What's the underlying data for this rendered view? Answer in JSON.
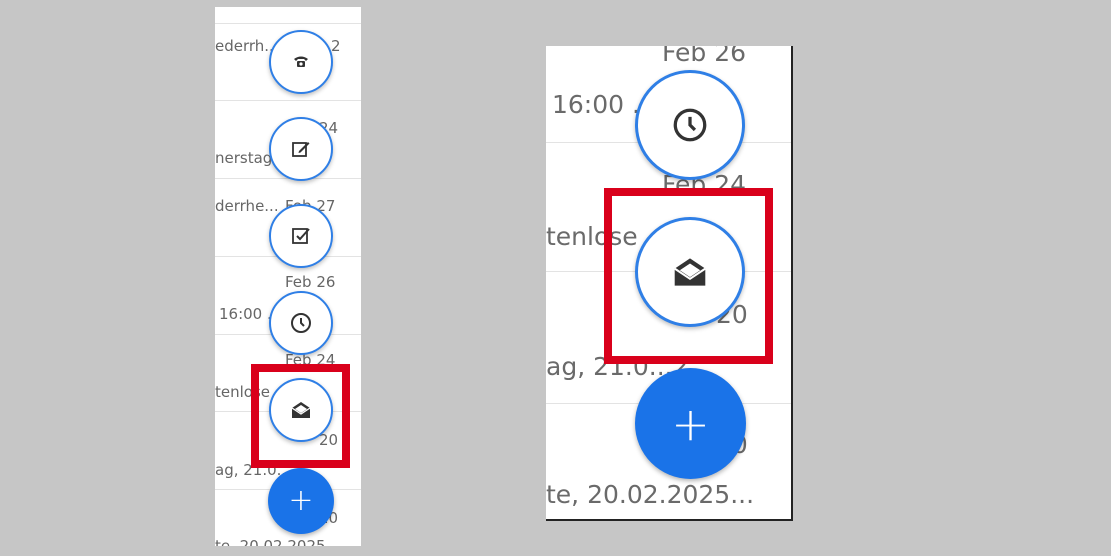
{
  "left_panel": {
    "rows": [
      {
        "title": "ederrh...",
        "date": "2"
      },
      {
        "title": "nerstag...",
        "date": "24"
      },
      {
        "title": "derrhe...",
        "date": "Feb 27"
      },
      {
        "title": "16:00 ...",
        "date": "Feb 26"
      },
      {
        "title": "tenlose ... o.",
        "date": "Feb 24"
      },
      {
        "title": "ag, 21.0...",
        "date": "20"
      },
      {
        "title": "te, 20.02.2025",
        "date": "20"
      }
    ],
    "menu_items": [
      {
        "icon": "phone-icon",
        "label": ""
      },
      {
        "icon": "edit-icon",
        "label": ""
      },
      {
        "icon": "task-check-icon",
        "label": ""
      },
      {
        "icon": "clock-icon",
        "label": ""
      },
      {
        "icon": "mail-open-icon",
        "label": ""
      }
    ],
    "add_button": {
      "icon": "plus-icon",
      "label": "+"
    }
  },
  "right_panel": {
    "rows": [
      {
        "title": "16:00 ...",
        "date": "Feb 26"
      },
      {
        "title": "tenlose ... o.",
        "date": "Feb 24"
      },
      {
        "title": "ag, 21.0...2...",
        "date": "20"
      },
      {
        "title": "te, 20.02.2025...",
        "date": "20"
      }
    ],
    "menu_items": [
      {
        "icon": "clock-icon",
        "label": ""
      },
      {
        "icon": "mail-open-icon",
        "label": ""
      }
    ],
    "add_button": {
      "icon": "plus-icon",
      "label": "+"
    }
  },
  "highlight_color": "#d9001b",
  "accent_color": "#1a73e8"
}
